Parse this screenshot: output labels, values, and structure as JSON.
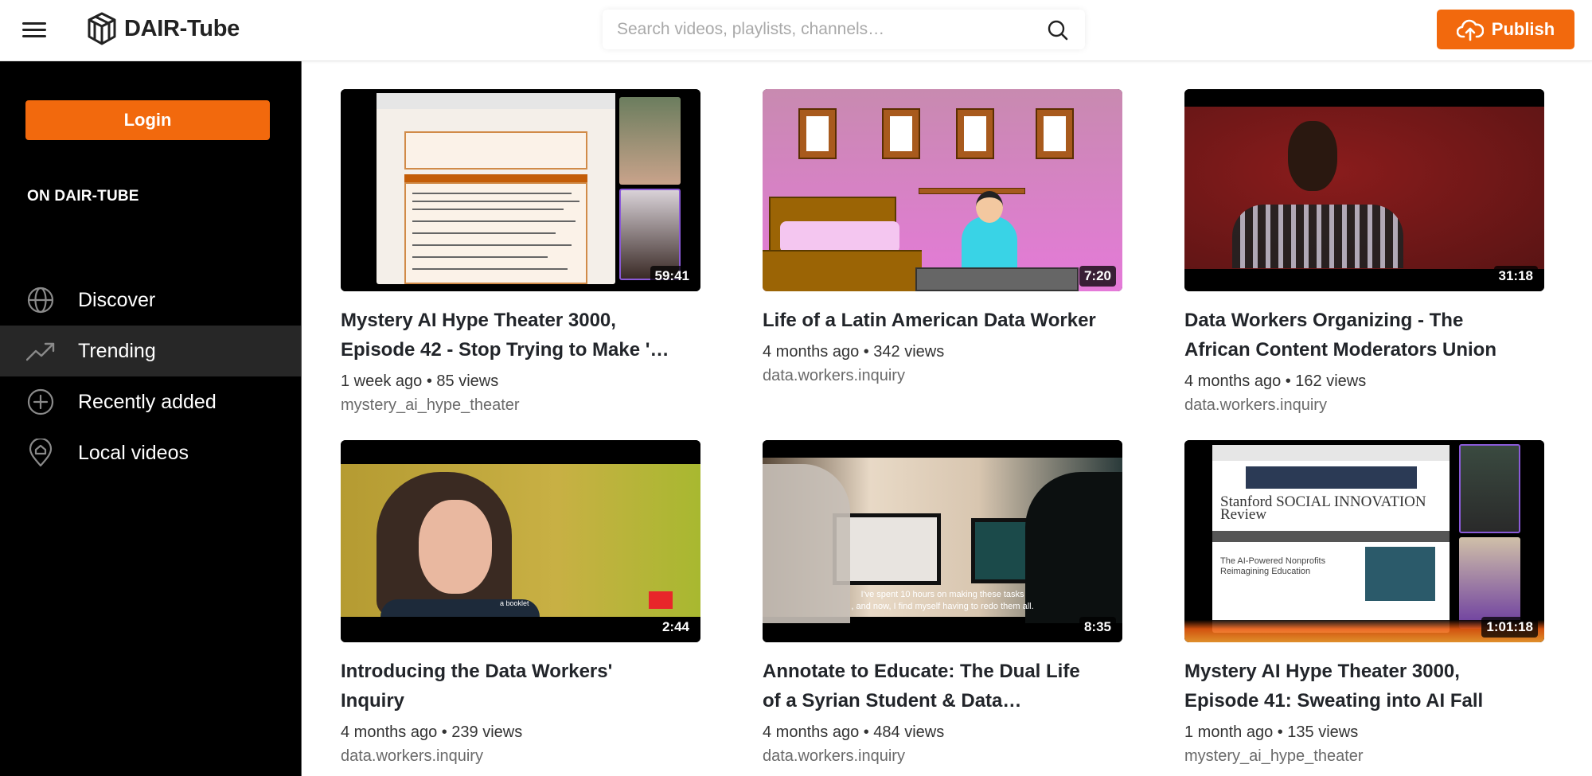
{
  "header": {
    "app_title": "DAIR-Tube",
    "search_placeholder": "Search videos, playlists, channels…",
    "search_value": "",
    "publish_label": "Publish",
    "icons": {
      "menu": "hamburger-menu-icon",
      "logo": "cube-logo-icon",
      "search": "search-icon",
      "publish": "cloud-upload-icon"
    }
  },
  "sidebar": {
    "login_label": "Login",
    "section_title": "ON DAIR-TUBE",
    "items": [
      {
        "label": "Discover",
        "icon": "globe-icon",
        "active": false
      },
      {
        "label": "Trending",
        "icon": "trending-up-icon",
        "active": true
      },
      {
        "label": "Recently added",
        "icon": "plus-circle-icon",
        "active": false
      },
      {
        "label": "Local videos",
        "icon": "home-pin-icon",
        "active": false
      }
    ]
  },
  "videos": [
    {
      "title": "Mystery AI Hype Theater 3000, Episode 42 - Stop Trying to Make '…",
      "age": "1 week ago",
      "views": "85 views",
      "meta": "1 week ago • 85 views",
      "channel": "mystery_ai_hype_theater",
      "duration": "59:41"
    },
    {
      "title": "Life of a Latin American Data Worker",
      "age": "4 months ago",
      "views": "342 views",
      "meta": "4 months ago • 342 views",
      "channel": "data.workers.inquiry",
      "duration": "7:20"
    },
    {
      "title": "Data Workers Organizing - The African Content Moderators Union",
      "age": "4 months ago",
      "views": "162 views",
      "meta": "4 months ago • 162 views",
      "channel": "data.workers.inquiry",
      "duration": "31:18"
    },
    {
      "title": "Introducing the Data Workers' Inquiry",
      "age": "4 months ago",
      "views": "239 views",
      "meta": "4 months ago • 239 views",
      "channel": "data.workers.inquiry",
      "duration": "2:44",
      "caption": "a booklet"
    },
    {
      "title": "Annotate to Educate: The Dual Life of a Syrian Student & Data…",
      "age": "4 months ago",
      "views": "484 views",
      "meta": "4 months ago • 484 views",
      "channel": "data.workers.inquiry",
      "duration": "8:35",
      "caption_line1": "I've spent 10 hours on making these tasks",
      "caption_line2": ", and now, I find myself having to redo them all."
    },
    {
      "title": "Mystery AI Hype Theater 3000, Episode 41: Sweating into AI Fall",
      "age": "1 month ago",
      "views": "135 views",
      "meta": "1 month ago • 135 views",
      "channel": "mystery_ai_hype_theater",
      "duration": "1:01:18",
      "thumb_site_title": "Stanford SOCIAL INNOVATION Review",
      "thumb_headline": "The AI-Powered Nonprofits Reimagining Education"
    }
  ],
  "colors": {
    "accent": "#f2690d",
    "sidebar_bg": "#000000",
    "sidebar_active": "#272727",
    "title_text": "#22252a",
    "channel_text": "#6a6a6a"
  }
}
